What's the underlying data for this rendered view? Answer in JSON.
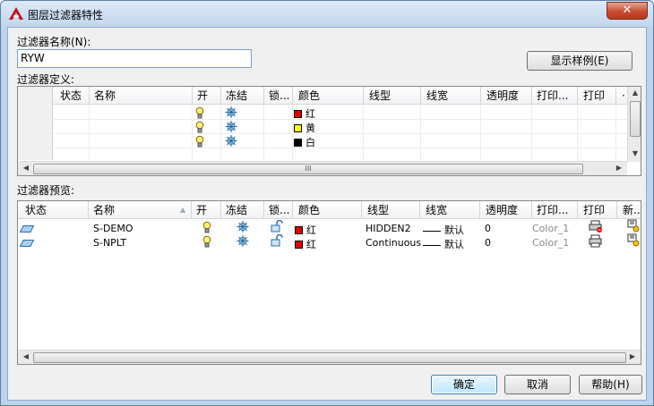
{
  "window": {
    "title": "图层过滤器特性",
    "close_label": "✕"
  },
  "filter_name": {
    "label": "过滤器名称(N):",
    "value": "RYW"
  },
  "show_example_label": "显示样例(E)",
  "definition": {
    "label": "过滤器定义:",
    "columns": [
      "状态",
      "名称",
      "开",
      "冻结",
      "锁...",
      "颜色",
      "线型",
      "线宽",
      "透明度",
      "打印...",
      "打印",
      "·"
    ],
    "rows": [
      {
        "on": "bulb-icon",
        "freeze": "sun-icon",
        "color_name": "红",
        "color_hex": "#e00000"
      },
      {
        "on": "bulb-icon",
        "freeze": "sun-icon",
        "color_name": "黄",
        "color_hex": "#ffff00"
      },
      {
        "on": "bulb-icon",
        "freeze": "sun-icon",
        "color_name": "白",
        "color_hex": "#000000"
      }
    ],
    "hscroll_grip": "III"
  },
  "preview": {
    "label": "过滤器预览:",
    "columns": [
      "状态",
      "名称",
      "开",
      "冻结",
      "锁...",
      "颜色",
      "线型",
      "线宽",
      "透明度",
      "打印...",
      "打印",
      "新..."
    ],
    "sort_indicator": "▲",
    "rows": [
      {
        "name": "S-DEMO",
        "color_name": "红",
        "color_hex": "#e00000",
        "linetype": "HIDDEN2",
        "lineweight": "默认",
        "transparency": "0",
        "plot_style": "Color_1",
        "plot": "no-plot-printer-icon"
      },
      {
        "name": "S-NPLT",
        "color_name": "红",
        "color_hex": "#e00000",
        "linetype": "Continuous",
        "lineweight": "默认",
        "transparency": "0",
        "plot_style": "Color_1",
        "plot": "printer-icon"
      }
    ]
  },
  "buttons": {
    "ok": "确定",
    "cancel": "取消",
    "help": "帮助(H)"
  }
}
